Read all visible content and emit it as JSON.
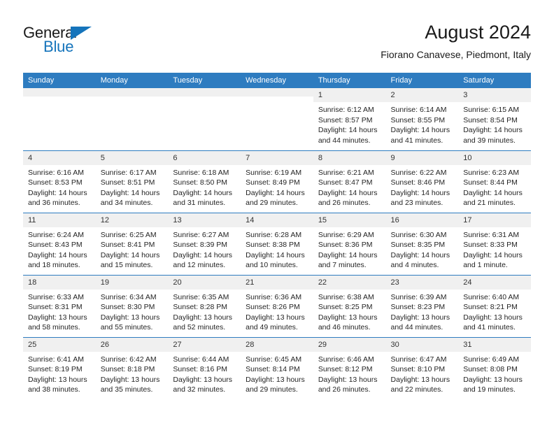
{
  "brand": {
    "name_part1": "General",
    "name_part2": "Blue",
    "triangle_icon": "triangle-icon",
    "color_primary": "#1574bb",
    "color_text": "#1a1a1a"
  },
  "header": {
    "title": "August 2024",
    "subtitle": "Fiorano Canavese, Piedmont, Italy"
  },
  "theme": {
    "header_band": "#2e7cc0",
    "daynum_band": "#f0f0f0",
    "text": "#242424"
  },
  "weekdays": [
    "Sunday",
    "Monday",
    "Tuesday",
    "Wednesday",
    "Thursday",
    "Friday",
    "Saturday"
  ],
  "weeks": [
    [
      {
        "day": "",
        "empty": true,
        "sunrise": "",
        "sunset": "",
        "daylight1": "",
        "daylight2": ""
      },
      {
        "day": "",
        "empty": true,
        "sunrise": "",
        "sunset": "",
        "daylight1": "",
        "daylight2": ""
      },
      {
        "day": "",
        "empty": true,
        "sunrise": "",
        "sunset": "",
        "daylight1": "",
        "daylight2": ""
      },
      {
        "day": "",
        "empty": true,
        "sunrise": "",
        "sunset": "",
        "daylight1": "",
        "daylight2": ""
      },
      {
        "day": "1",
        "empty": false,
        "sunrise": "Sunrise: 6:12 AM",
        "sunset": "Sunset: 8:57 PM",
        "daylight1": "Daylight: 14 hours",
        "daylight2": "and 44 minutes."
      },
      {
        "day": "2",
        "empty": false,
        "sunrise": "Sunrise: 6:14 AM",
        "sunset": "Sunset: 8:55 PM",
        "daylight1": "Daylight: 14 hours",
        "daylight2": "and 41 minutes."
      },
      {
        "day": "3",
        "empty": false,
        "sunrise": "Sunrise: 6:15 AM",
        "sunset": "Sunset: 8:54 PM",
        "daylight1": "Daylight: 14 hours",
        "daylight2": "and 39 minutes."
      }
    ],
    [
      {
        "day": "4",
        "empty": false,
        "sunrise": "Sunrise: 6:16 AM",
        "sunset": "Sunset: 8:53 PM",
        "daylight1": "Daylight: 14 hours",
        "daylight2": "and 36 minutes."
      },
      {
        "day": "5",
        "empty": false,
        "sunrise": "Sunrise: 6:17 AM",
        "sunset": "Sunset: 8:51 PM",
        "daylight1": "Daylight: 14 hours",
        "daylight2": "and 34 minutes."
      },
      {
        "day": "6",
        "empty": false,
        "sunrise": "Sunrise: 6:18 AM",
        "sunset": "Sunset: 8:50 PM",
        "daylight1": "Daylight: 14 hours",
        "daylight2": "and 31 minutes."
      },
      {
        "day": "7",
        "empty": false,
        "sunrise": "Sunrise: 6:19 AM",
        "sunset": "Sunset: 8:49 PM",
        "daylight1": "Daylight: 14 hours",
        "daylight2": "and 29 minutes."
      },
      {
        "day": "8",
        "empty": false,
        "sunrise": "Sunrise: 6:21 AM",
        "sunset": "Sunset: 8:47 PM",
        "daylight1": "Daylight: 14 hours",
        "daylight2": "and 26 minutes."
      },
      {
        "day": "9",
        "empty": false,
        "sunrise": "Sunrise: 6:22 AM",
        "sunset": "Sunset: 8:46 PM",
        "daylight1": "Daylight: 14 hours",
        "daylight2": "and 23 minutes."
      },
      {
        "day": "10",
        "empty": false,
        "sunrise": "Sunrise: 6:23 AM",
        "sunset": "Sunset: 8:44 PM",
        "daylight1": "Daylight: 14 hours",
        "daylight2": "and 21 minutes."
      }
    ],
    [
      {
        "day": "11",
        "empty": false,
        "sunrise": "Sunrise: 6:24 AM",
        "sunset": "Sunset: 8:43 PM",
        "daylight1": "Daylight: 14 hours",
        "daylight2": "and 18 minutes."
      },
      {
        "day": "12",
        "empty": false,
        "sunrise": "Sunrise: 6:25 AM",
        "sunset": "Sunset: 8:41 PM",
        "daylight1": "Daylight: 14 hours",
        "daylight2": "and 15 minutes."
      },
      {
        "day": "13",
        "empty": false,
        "sunrise": "Sunrise: 6:27 AM",
        "sunset": "Sunset: 8:39 PM",
        "daylight1": "Daylight: 14 hours",
        "daylight2": "and 12 minutes."
      },
      {
        "day": "14",
        "empty": false,
        "sunrise": "Sunrise: 6:28 AM",
        "sunset": "Sunset: 8:38 PM",
        "daylight1": "Daylight: 14 hours",
        "daylight2": "and 10 minutes."
      },
      {
        "day": "15",
        "empty": false,
        "sunrise": "Sunrise: 6:29 AM",
        "sunset": "Sunset: 8:36 PM",
        "daylight1": "Daylight: 14 hours",
        "daylight2": "and 7 minutes."
      },
      {
        "day": "16",
        "empty": false,
        "sunrise": "Sunrise: 6:30 AM",
        "sunset": "Sunset: 8:35 PM",
        "daylight1": "Daylight: 14 hours",
        "daylight2": "and 4 minutes."
      },
      {
        "day": "17",
        "empty": false,
        "sunrise": "Sunrise: 6:31 AM",
        "sunset": "Sunset: 8:33 PM",
        "daylight1": "Daylight: 14 hours",
        "daylight2": "and 1 minute."
      }
    ],
    [
      {
        "day": "18",
        "empty": false,
        "sunrise": "Sunrise: 6:33 AM",
        "sunset": "Sunset: 8:31 PM",
        "daylight1": "Daylight: 13 hours",
        "daylight2": "and 58 minutes."
      },
      {
        "day": "19",
        "empty": false,
        "sunrise": "Sunrise: 6:34 AM",
        "sunset": "Sunset: 8:30 PM",
        "daylight1": "Daylight: 13 hours",
        "daylight2": "and 55 minutes."
      },
      {
        "day": "20",
        "empty": false,
        "sunrise": "Sunrise: 6:35 AM",
        "sunset": "Sunset: 8:28 PM",
        "daylight1": "Daylight: 13 hours",
        "daylight2": "and 52 minutes."
      },
      {
        "day": "21",
        "empty": false,
        "sunrise": "Sunrise: 6:36 AM",
        "sunset": "Sunset: 8:26 PM",
        "daylight1": "Daylight: 13 hours",
        "daylight2": "and 49 minutes."
      },
      {
        "day": "22",
        "empty": false,
        "sunrise": "Sunrise: 6:38 AM",
        "sunset": "Sunset: 8:25 PM",
        "daylight1": "Daylight: 13 hours",
        "daylight2": "and 46 minutes."
      },
      {
        "day": "23",
        "empty": false,
        "sunrise": "Sunrise: 6:39 AM",
        "sunset": "Sunset: 8:23 PM",
        "daylight1": "Daylight: 13 hours",
        "daylight2": "and 44 minutes."
      },
      {
        "day": "24",
        "empty": false,
        "sunrise": "Sunrise: 6:40 AM",
        "sunset": "Sunset: 8:21 PM",
        "daylight1": "Daylight: 13 hours",
        "daylight2": "and 41 minutes."
      }
    ],
    [
      {
        "day": "25",
        "empty": false,
        "sunrise": "Sunrise: 6:41 AM",
        "sunset": "Sunset: 8:19 PM",
        "daylight1": "Daylight: 13 hours",
        "daylight2": "and 38 minutes."
      },
      {
        "day": "26",
        "empty": false,
        "sunrise": "Sunrise: 6:42 AM",
        "sunset": "Sunset: 8:18 PM",
        "daylight1": "Daylight: 13 hours",
        "daylight2": "and 35 minutes."
      },
      {
        "day": "27",
        "empty": false,
        "sunrise": "Sunrise: 6:44 AM",
        "sunset": "Sunset: 8:16 PM",
        "daylight1": "Daylight: 13 hours",
        "daylight2": "and 32 minutes."
      },
      {
        "day": "28",
        "empty": false,
        "sunrise": "Sunrise: 6:45 AM",
        "sunset": "Sunset: 8:14 PM",
        "daylight1": "Daylight: 13 hours",
        "daylight2": "and 29 minutes."
      },
      {
        "day": "29",
        "empty": false,
        "sunrise": "Sunrise: 6:46 AM",
        "sunset": "Sunset: 8:12 PM",
        "daylight1": "Daylight: 13 hours",
        "daylight2": "and 26 minutes."
      },
      {
        "day": "30",
        "empty": false,
        "sunrise": "Sunrise: 6:47 AM",
        "sunset": "Sunset: 8:10 PM",
        "daylight1": "Daylight: 13 hours",
        "daylight2": "and 22 minutes."
      },
      {
        "day": "31",
        "empty": false,
        "sunrise": "Sunrise: 6:49 AM",
        "sunset": "Sunset: 8:08 PM",
        "daylight1": "Daylight: 13 hours",
        "daylight2": "and 19 minutes."
      }
    ]
  ]
}
